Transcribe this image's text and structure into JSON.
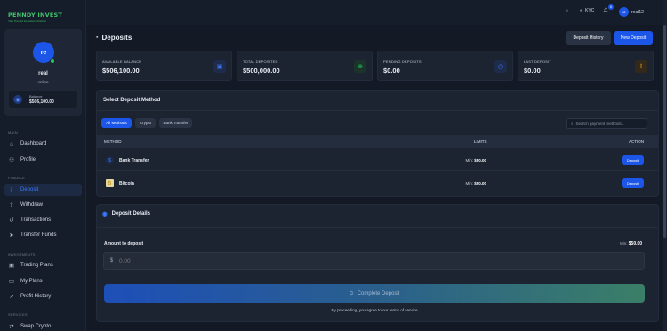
{
  "brand": {
    "name": "PENNDY INVEST",
    "tagline": "Your Trusted Investment Partner"
  },
  "profile": {
    "initials": "re",
    "name": "real",
    "status": "online",
    "balance_label": "Balance",
    "balance_value": "$506,100.00"
  },
  "sidebar": {
    "sections": {
      "main": "MAIN",
      "finance": "FINANCE",
      "investments": "INVESTMENTS",
      "services": "SERVICES"
    },
    "items": [
      {
        "label": "Dashboard",
        "icon": "dashboard-icon"
      },
      {
        "label": "Profile",
        "icon": "user-icon"
      },
      {
        "label": "Deposit",
        "icon": "deposit-icon"
      },
      {
        "label": "Withdraw",
        "icon": "withdraw-icon"
      },
      {
        "label": "Transactions",
        "icon": "history-icon"
      },
      {
        "label": "Transfer Funds",
        "icon": "transfer-icon"
      },
      {
        "label": "Trading Plans",
        "icon": "briefcase-icon"
      },
      {
        "label": "My Plans",
        "icon": "folder-icon"
      },
      {
        "label": "Profit History",
        "icon": "trend-icon"
      },
      {
        "label": "Swap Crypto",
        "icon": "swap-icon"
      }
    ]
  },
  "topbar": {
    "kyc_label": "KYC",
    "notification_count": "6",
    "user_initials": "re",
    "username": "real12"
  },
  "page": {
    "title": "Deposits",
    "history_button": "Deposit History",
    "new_button": "New Deposit"
  },
  "stats": [
    {
      "label": "AVAILABLE BALANCE",
      "value": "$506,100.00",
      "icon": "wallet-icon",
      "color": "#3a78ff"
    },
    {
      "label": "TOTAL DEPOSITED",
      "value": "$500,000.00",
      "icon": "arrow-down-circle-icon",
      "color": "#22c55e"
    },
    {
      "label": "PENDING DEPOSITS",
      "value": "$0.00",
      "icon": "clock-icon",
      "color": "#3a78ff"
    },
    {
      "label": "LAST DEPOSIT",
      "value": "$0.00",
      "icon": "download-icon",
      "color": "#f0a020"
    }
  ],
  "methods_panel": {
    "title": "Select Deposit Method",
    "filters": [
      "All Methods",
      "Crypto",
      "Bank Transfer"
    ],
    "search_placeholder": "Search payment methods...",
    "columns": {
      "method": "METHOD",
      "limits": "LIMITS",
      "action": "ACTION"
    },
    "rows": [
      {
        "name": "Bank Transfer",
        "min_label": "Min:",
        "min_value": "$50.00",
        "action": "Deposit",
        "icon": "bank-icon"
      },
      {
        "name": "Bitcoin",
        "min_label": "Min:",
        "min_value": "$50.00",
        "action": "Deposit",
        "icon": "bitcoin-icon"
      }
    ]
  },
  "details_panel": {
    "title": "Deposit Details",
    "amount_label": "Amount to deposit",
    "min_label": "Min:",
    "min_value": "$50.00",
    "currency": "$",
    "amount_placeholder": "0.00",
    "submit_label": "Complete Deposit",
    "terms": "By proceeding, you agree to our terms of service"
  }
}
